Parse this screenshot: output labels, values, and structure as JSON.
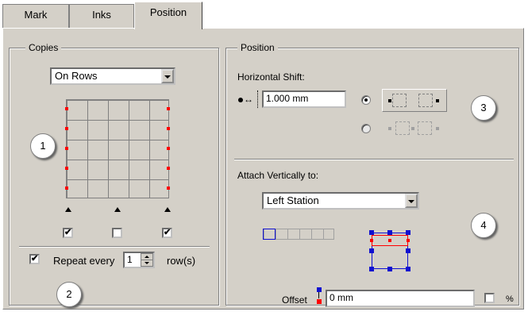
{
  "tabs": [
    {
      "label": "Mark"
    },
    {
      "label": "Inks"
    },
    {
      "label": "Position"
    }
  ],
  "copies": {
    "title": "Copies",
    "dropdown_value": "On Rows",
    "badge_1": "1",
    "repeat_label": "Repeat every",
    "repeat_value": "1",
    "repeat_unit": "row(s)",
    "badge_2": "2",
    "checkboxes": [
      true,
      false,
      true
    ],
    "repeat_checked": true
  },
  "position": {
    "title": "Position",
    "horizontal_shift_label": "Horizontal Shift:",
    "horizontal_shift_value": "1.000 mm",
    "badge_3": "3",
    "attach_label": "Attach Vertically to:",
    "attach_value": "Left Station",
    "badge_4": "4",
    "offset_label": "Offset",
    "offset_value": "0 mm",
    "percent_label": "%",
    "shift_option_selected": 0,
    "percent_checked": false
  },
  "colors": {
    "panel_bg": "#d4d0c8",
    "marker_red": "#ff0000",
    "marker_blue": "#1010d0"
  }
}
